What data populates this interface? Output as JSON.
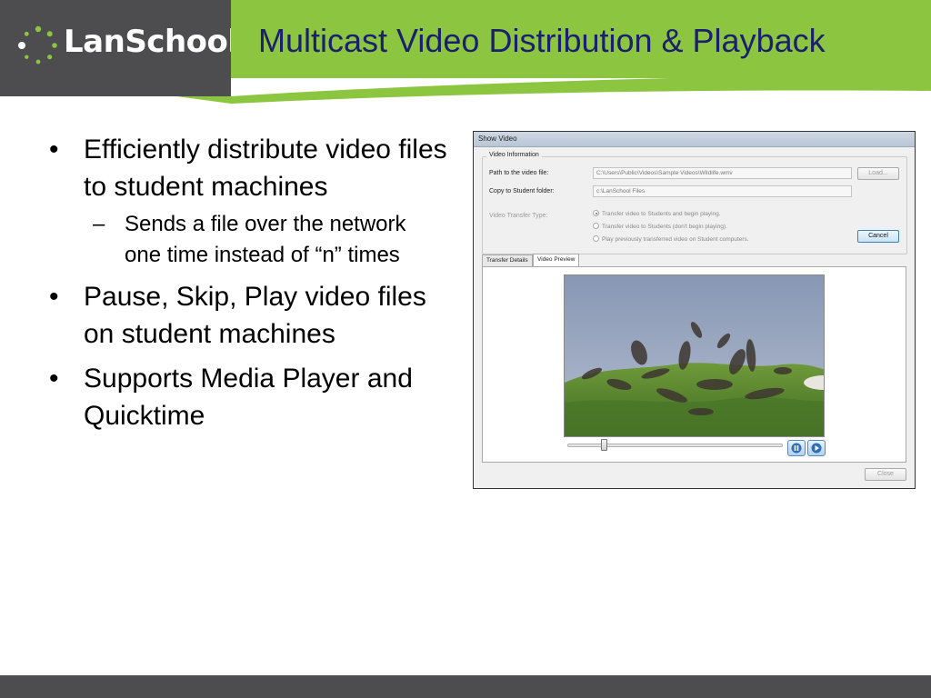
{
  "header": {
    "logo_text": "LanSchool",
    "title": "Multicast Video Distribution & Playback"
  },
  "bullets": [
    {
      "text": "Efficiently distribute video files to student machines",
      "sub": [
        "Sends a file over the network one time instead of “n” times"
      ]
    },
    {
      "text": "Pause, Skip, Play video files on student machines",
      "sub": []
    },
    {
      "text": "Supports Media Player and Quicktime",
      "sub": []
    }
  ],
  "bullet_marker": "•",
  "sub_marker": "–",
  "window": {
    "title": "Show Video",
    "group_label": "Video Information",
    "path_label": "Path to the video file:",
    "path_value": "C:\\Users\\Public\\Videos\\Sample Videos\\Wildlife.wmv",
    "load_label": "Load...",
    "folder_label": "Copy to Student folder:",
    "folder_value": "c:\\LanSchool Files",
    "transfer_type_label": "Video Transfer Type:",
    "options": [
      "Transfer video to Students and begin playing.",
      "Transfer video to Students (don't begin playing).",
      "Play previously transferred video on Student computers."
    ],
    "selected_option": 0,
    "cancel_label": "Cancel",
    "tabs": [
      "Transfer Details",
      "Video Preview"
    ],
    "selected_tab": 1,
    "playback_position": 0.17,
    "pause_icon": "pause-icon",
    "play_icon": "play-icon",
    "close_label": "Close"
  },
  "colors": {
    "header_gray": "#4d4d4f",
    "header_green": "#8cc540",
    "title_navy": "#1a1f6e"
  }
}
